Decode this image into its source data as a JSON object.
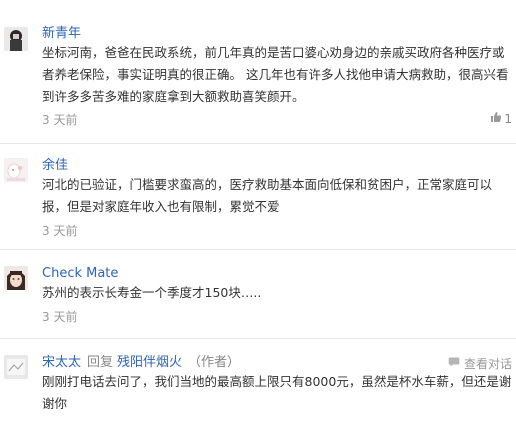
{
  "comments": [
    {
      "name": "新青年",
      "body": "坐标河南，爸爸在民政系统，前几年真的是苦口婆心劝身边的亲戚买政府各种医疗或者养老保险，事实证明真的很正确。 这几年也有许多人找他申请大病救助，很高兴看到许多多苦多难的家庭拿到大额救助喜笑颜开。",
      "time": "3 天前",
      "likes": "1"
    },
    {
      "name": "余佳",
      "body": "河北的已验证，门槛要求蛮高的，医疗救助基本面向低保和贫困户，正常家庭可以报，但是对家庭年收入也有限制，累觉不爱",
      "time": "3 天前"
    },
    {
      "name": "Check Mate",
      "body": "苏州的表示长寿金一个季度才150块…..",
      "time": "3 天前"
    },
    {
      "name": "宋太太",
      "reply_word": "回复",
      "reply_target": "残阳伴烟火",
      "author_tag": "（作者）",
      "view_conversation": "查看对话",
      "body": "刚刚打电话去问了，我们当地的最高额上限只有8000元，虽然是杯水车薪，但还是谢谢你"
    }
  ],
  "icons": {
    "like": "thumbs-up-icon",
    "conversation": "speech-bubble-icon"
  },
  "colors": {
    "link": "#2d64b3",
    "meta": "#999999",
    "text": "#333333",
    "divider": "#e8e8e8"
  }
}
